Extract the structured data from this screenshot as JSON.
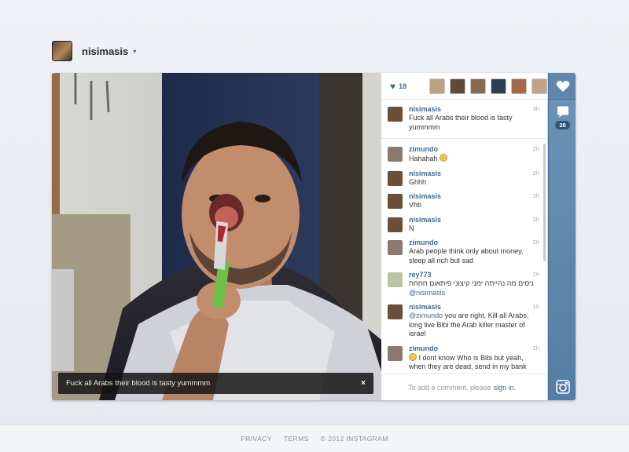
{
  "header": {
    "username": "nisimasis",
    "caret": "▾"
  },
  "photo": {
    "caption": "Fuck all Arabs their blood is tasty yummmm",
    "close_label": "×"
  },
  "likes": {
    "count": "18",
    "liker_colors": [
      "#b9a27f",
      "#5d4a3c",
      "#8a6a50",
      "#2d3e52",
      "#a36b4a",
      "#c2a284"
    ]
  },
  "comments": [
    {
      "user": "nisimasis",
      "time": "3h",
      "text": "Fuck all Arabs their blood is tasty yummmm",
      "avatar": "#6a5038"
    },
    {
      "user": "zimundo",
      "time": "2h",
      "text": "Hahahah",
      "smiley": true,
      "avatar": "#8c7a70"
    },
    {
      "user": "nisimasis",
      "time": "2h",
      "text": "Ghhh",
      "avatar": "#6a5038"
    },
    {
      "user": "nisimasis",
      "time": "2h",
      "text": "Vhb",
      "avatar": "#6a5038"
    },
    {
      "user": "nisimasis",
      "time": "2h",
      "text": "N",
      "avatar": "#6a5038"
    },
    {
      "user": "zimundo",
      "time": "2h",
      "text": "Arab people think only about money, sleep all rich but sad",
      "avatar": "#8c7a70"
    },
    {
      "user": "rey773",
      "time": "2h",
      "text": "ניסים מה נהייתה ימני קיצוני פיתאום חחחח",
      "mention": "@nisimasis",
      "avatar": "#b9c4a0"
    },
    {
      "user": "nisimasis",
      "time": "1h",
      "mention": "@zimundo",
      "text": " you are right. Kill all Arabs, long live Bibi the Arab killer master of israel",
      "avatar": "#6a5038"
    },
    {
      "user": "zimundo",
      "time": "1h",
      "text": " I dont know Who is Bibi but yeah, when they are dead, send in my bank",
      "smiley": true,
      "avatar": "#8c7a70"
    }
  ],
  "add_comment": {
    "prompt": "To add a comment, please",
    "link": "sign in."
  },
  "rail": {
    "comment_count": "28"
  },
  "footer": {
    "privacy": "PRIVACY",
    "dot": "·",
    "terms": "TERMS",
    "copyright": "© 2012 INSTAGRAM"
  },
  "colors": {
    "link": "#3d6a94",
    "rail": "#6d93b8"
  }
}
